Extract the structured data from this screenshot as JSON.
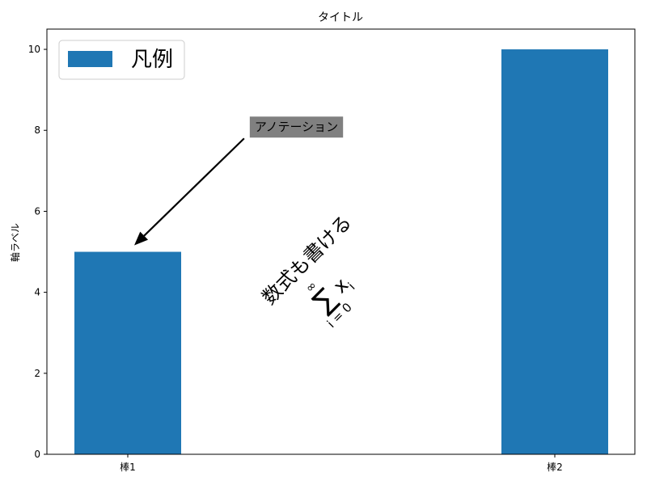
{
  "chart_data": {
    "type": "bar",
    "title": "タイトル",
    "xlabel": "",
    "ylabel": "軸ラベル",
    "categories": [
      "棒1",
      "棒2"
    ],
    "series": [
      {
        "name": "凡例",
        "values": [
          5,
          10
        ],
        "color": "#1f77b4"
      }
    ],
    "ylim": [
      0,
      10.5
    ],
    "yticks": [
      0,
      2,
      4,
      6,
      8,
      10
    ],
    "grid": false,
    "legend_position": "top-left",
    "annotations": [
      {
        "text": "アノテーション",
        "xy": [
          0,
          5.1
        ],
        "text_xy": [
          0.28,
          8.1
        ],
        "text_color": "#ffff00",
        "box_color": "#808080",
        "arrow": true
      }
    ],
    "rotated_text": {
      "text": "数式も書ける",
      "color": "#d62728",
      "rotation": 45,
      "math": {
        "symbol": "∑",
        "upper": "∞",
        "lower": "i = 0",
        "term": "x",
        "term_sub": "i"
      }
    }
  }
}
